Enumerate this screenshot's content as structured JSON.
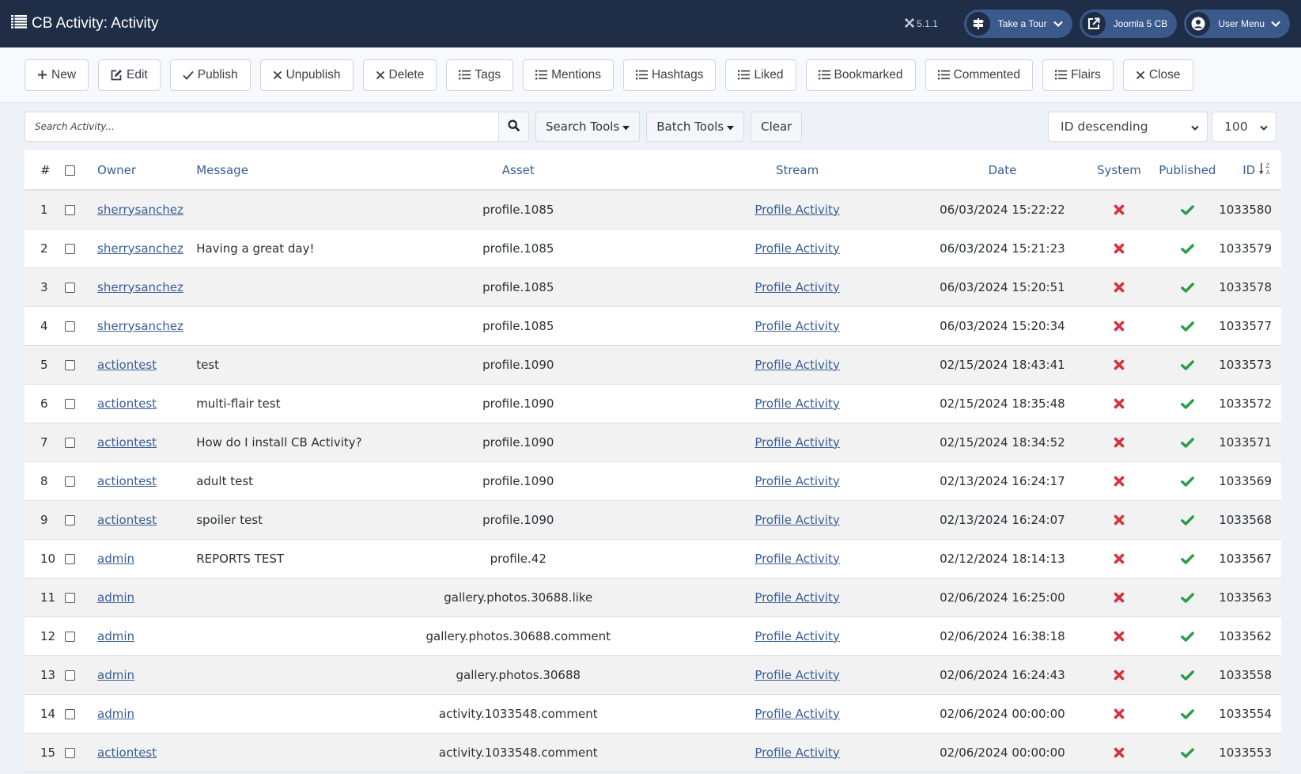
{
  "header": {
    "title": "CB Activity: Activity",
    "version": "5.1.1",
    "buttons": [
      {
        "label": "Take a Tour",
        "icon": "signpost-icon",
        "has_dropdown": true
      },
      {
        "label": "Joomla 5 CB",
        "icon": "external-link-icon",
        "has_dropdown": false
      },
      {
        "label": "User Menu",
        "icon": "user-circle-icon",
        "has_dropdown": true
      }
    ]
  },
  "toolbar": {
    "buttons": [
      {
        "label": "New",
        "icon": "plus-icon"
      },
      {
        "label": "Edit",
        "icon": "edit-icon"
      },
      {
        "label": "Publish",
        "icon": "check-icon"
      },
      {
        "label": "Unpublish",
        "icon": "times-icon"
      },
      {
        "label": "Delete",
        "icon": "times-icon"
      },
      {
        "label": "Tags",
        "icon": "list-icon"
      },
      {
        "label": "Mentions",
        "icon": "list-icon"
      },
      {
        "label": "Hashtags",
        "icon": "list-icon"
      },
      {
        "label": "Liked",
        "icon": "list-icon"
      },
      {
        "label": "Bookmarked",
        "icon": "list-icon"
      },
      {
        "label": "Commented",
        "icon": "list-icon"
      },
      {
        "label": "Flairs",
        "icon": "list-icon"
      },
      {
        "label": "Close",
        "icon": "times-icon"
      }
    ]
  },
  "filters": {
    "search_placeholder": "Search Activity...",
    "search_value": "",
    "search_tools_label": "Search Tools",
    "batch_tools_label": "Batch Tools",
    "clear_label": "Clear",
    "sort_selected": "ID descending",
    "limit_selected": "100"
  },
  "table": {
    "columns": [
      "#",
      "",
      "Owner",
      "Message",
      "Asset",
      "Stream",
      "Date",
      "System",
      "Published",
      "ID"
    ],
    "sort_column": "ID",
    "sort_direction": "descending",
    "colors": {
      "system_no": "#d9303e",
      "published_yes": "#2a9d46",
      "link": "#3a5e96"
    },
    "rows": [
      {
        "num": "1",
        "owner": "sherrysanchez",
        "message": "",
        "asset": "profile.1085",
        "stream": "Profile Activity",
        "date": "06/03/2024 15:22:22",
        "system": false,
        "published": true,
        "id": "1033580"
      },
      {
        "num": "2",
        "owner": "sherrysanchez",
        "message": "Having a great day!",
        "asset": "profile.1085",
        "stream": "Profile Activity",
        "date": "06/03/2024 15:21:23",
        "system": false,
        "published": true,
        "id": "1033579"
      },
      {
        "num": "3",
        "owner": "sherrysanchez",
        "message": "",
        "asset": "profile.1085",
        "stream": "Profile Activity",
        "date": "06/03/2024 15:20:51",
        "system": false,
        "published": true,
        "id": "1033578"
      },
      {
        "num": "4",
        "owner": "sherrysanchez",
        "message": "",
        "asset": "profile.1085",
        "stream": "Profile Activity",
        "date": "06/03/2024 15:20:34",
        "system": false,
        "published": true,
        "id": "1033577"
      },
      {
        "num": "5",
        "owner": "actiontest",
        "message": "test",
        "asset": "profile.1090",
        "stream": "Profile Activity",
        "date": "02/15/2024 18:43:41",
        "system": false,
        "published": true,
        "id": "1033573"
      },
      {
        "num": "6",
        "owner": "actiontest",
        "message": "multi-flair test",
        "asset": "profile.1090",
        "stream": "Profile Activity",
        "date": "02/15/2024 18:35:48",
        "system": false,
        "published": true,
        "id": "1033572"
      },
      {
        "num": "7",
        "owner": "actiontest",
        "message": "How do I install CB Activity?",
        "asset": "profile.1090",
        "stream": "Profile Activity",
        "date": "02/15/2024 18:34:52",
        "system": false,
        "published": true,
        "id": "1033571"
      },
      {
        "num": "8",
        "owner": "actiontest",
        "message": "adult test",
        "asset": "profile.1090",
        "stream": "Profile Activity",
        "date": "02/13/2024 16:24:17",
        "system": false,
        "published": true,
        "id": "1033569"
      },
      {
        "num": "9",
        "owner": "actiontest",
        "message": "spoiler test",
        "asset": "profile.1090",
        "stream": "Profile Activity",
        "date": "02/13/2024 16:24:07",
        "system": false,
        "published": true,
        "id": "1033568"
      },
      {
        "num": "10",
        "owner": "admin",
        "message": "REPORTS TEST",
        "asset": "profile.42",
        "stream": "Profile Activity",
        "date": "02/12/2024 18:14:13",
        "system": false,
        "published": true,
        "id": "1033567"
      },
      {
        "num": "11",
        "owner": "admin",
        "message": "",
        "asset": "gallery.photos.30688.like",
        "stream": "Profile Activity",
        "date": "02/06/2024 16:25:00",
        "system": false,
        "published": true,
        "id": "1033563"
      },
      {
        "num": "12",
        "owner": "admin",
        "message": "",
        "asset": "gallery.photos.30688.comment",
        "stream": "Profile Activity",
        "date": "02/06/2024 16:38:18",
        "system": false,
        "published": true,
        "id": "1033562"
      },
      {
        "num": "13",
        "owner": "admin",
        "message": "",
        "asset": "gallery.photos.30688",
        "stream": "Profile Activity",
        "date": "02/06/2024 16:24:43",
        "system": false,
        "published": true,
        "id": "1033558"
      },
      {
        "num": "14",
        "owner": "admin",
        "message": "",
        "asset": "activity.1033548.comment",
        "stream": "Profile Activity",
        "date": "02/06/2024 00:00:00",
        "system": false,
        "published": true,
        "id": "1033554"
      },
      {
        "num": "15",
        "owner": "actiontest",
        "message": "",
        "asset": "activity.1033548.comment",
        "stream": "Profile Activity",
        "date": "02/06/2024 00:00:00",
        "system": false,
        "published": true,
        "id": "1033553"
      }
    ]
  }
}
